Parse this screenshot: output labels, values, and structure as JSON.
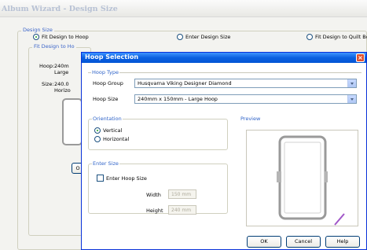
{
  "album": {
    "title": "Album Wizard - Design Size",
    "design_size_label": "Design Size",
    "radio_fit_hoop": "Fit Design to Hoop",
    "radio_enter_size": "Enter Design Size",
    "radio_fit_quilt": "Fit Design to Quilt Bo",
    "fit_hoop_label": "Fit Design to Ho",
    "hoop_label": "Hoop:",
    "hoop_value_1": "240m",
    "hoop_value_2": "Large",
    "size_label": "Size:",
    "size_value_1": "240.0",
    "size_value_2": "Horizo",
    "partial_button": "O"
  },
  "dialog": {
    "title": "Hoop Selection",
    "close_glyph": "×",
    "hoop_type_label": "Hoop Type",
    "hoop_group_label": "Hoop Group",
    "hoop_group_value": "Husqvarna Viking Designer Diamond",
    "hoop_size_label": "Hoop Size",
    "hoop_size_value": "240mm x 150mm - Large Hoop",
    "orientation_label": "Orientation",
    "vertical_label": "Vertical",
    "horizontal_label": "Horizontal",
    "orientation_selected": "vertical",
    "enter_size_label": "Enter Size",
    "enter_hoop_size_label": "Enter Hoop Size",
    "enter_hoop_size_checked": false,
    "width_label": "Width",
    "width_value": "150 mm",
    "height_label": "Height",
    "height_value": "240 mm",
    "preview_label": "Preview",
    "ok_label": "OK",
    "cancel_label": "Cancel",
    "help_label": "Help"
  },
  "colors": {
    "titlebar": "#0a5fe0",
    "group_title": "#2f63c8",
    "selected_radio": "#21a121",
    "close_button": "#e0512f"
  }
}
